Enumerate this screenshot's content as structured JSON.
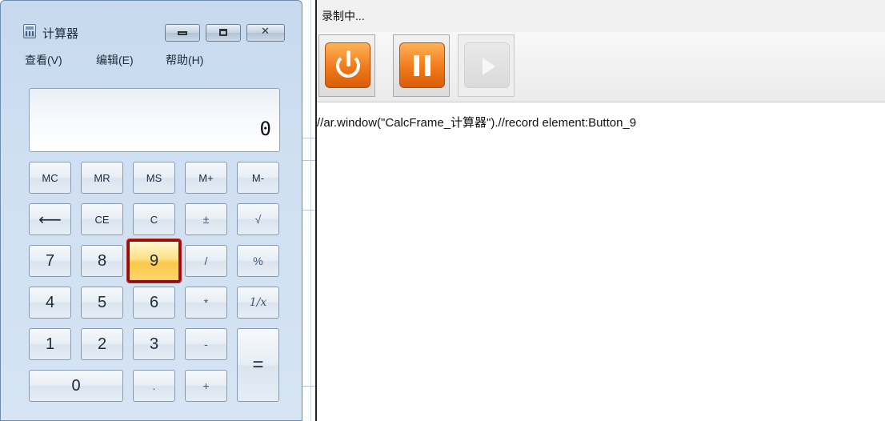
{
  "calculator": {
    "title": "计算器",
    "menu": [
      "查看(V)",
      "编辑(E)",
      "帮助(H)"
    ],
    "display_value": "0",
    "memory_keys": [
      "MC",
      "MR",
      "MS",
      "M+",
      "M-"
    ],
    "func_keys": [
      "⟵",
      "CE",
      "C",
      "±",
      "√"
    ],
    "row3": [
      "7",
      "8",
      "9",
      "/",
      "%"
    ],
    "row4": [
      "4",
      "5",
      "6",
      "*",
      "1/x"
    ],
    "row5": [
      "1",
      "2",
      "3",
      "-"
    ],
    "row6": [
      "0",
      ".",
      "+"
    ],
    "equals": "=",
    "highlighted_key": "9",
    "highlight_color": "#8b0f0f"
  },
  "recorder": {
    "status": "录制中...",
    "buttons": [
      "stop",
      "pause",
      "play"
    ],
    "script_line": "//ar.window(\"CalcFrame_计算器\").//record element:Button_9",
    "accent": "#f07a1a"
  }
}
